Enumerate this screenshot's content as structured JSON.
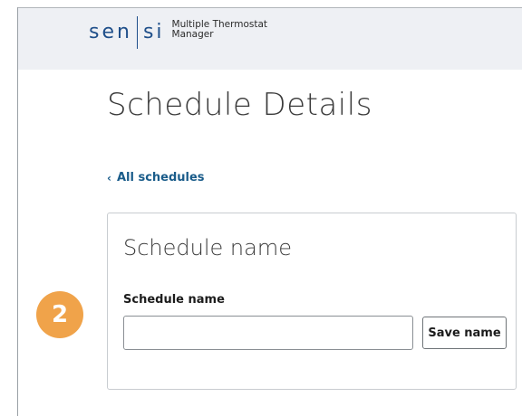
{
  "header": {
    "logo_left": "sen",
    "logo_right": "si",
    "app_name_line1": "Multiple Thermostat",
    "app_name_line2": "Manager"
  },
  "page": {
    "title": "Schedule Details",
    "back_link": "All schedules",
    "back_icon": "chevron-left-icon"
  },
  "card": {
    "title": "Schedule name",
    "field_label": "Schedule name",
    "input_value": "",
    "input_placeholder": "",
    "save_label": "Save name"
  },
  "annotation": {
    "step_number": "2",
    "badge_color": "#f0a34a"
  },
  "colors": {
    "brand": "#1f4f8a",
    "link": "#1a5c8a",
    "header_bg": "#eef0f4"
  }
}
